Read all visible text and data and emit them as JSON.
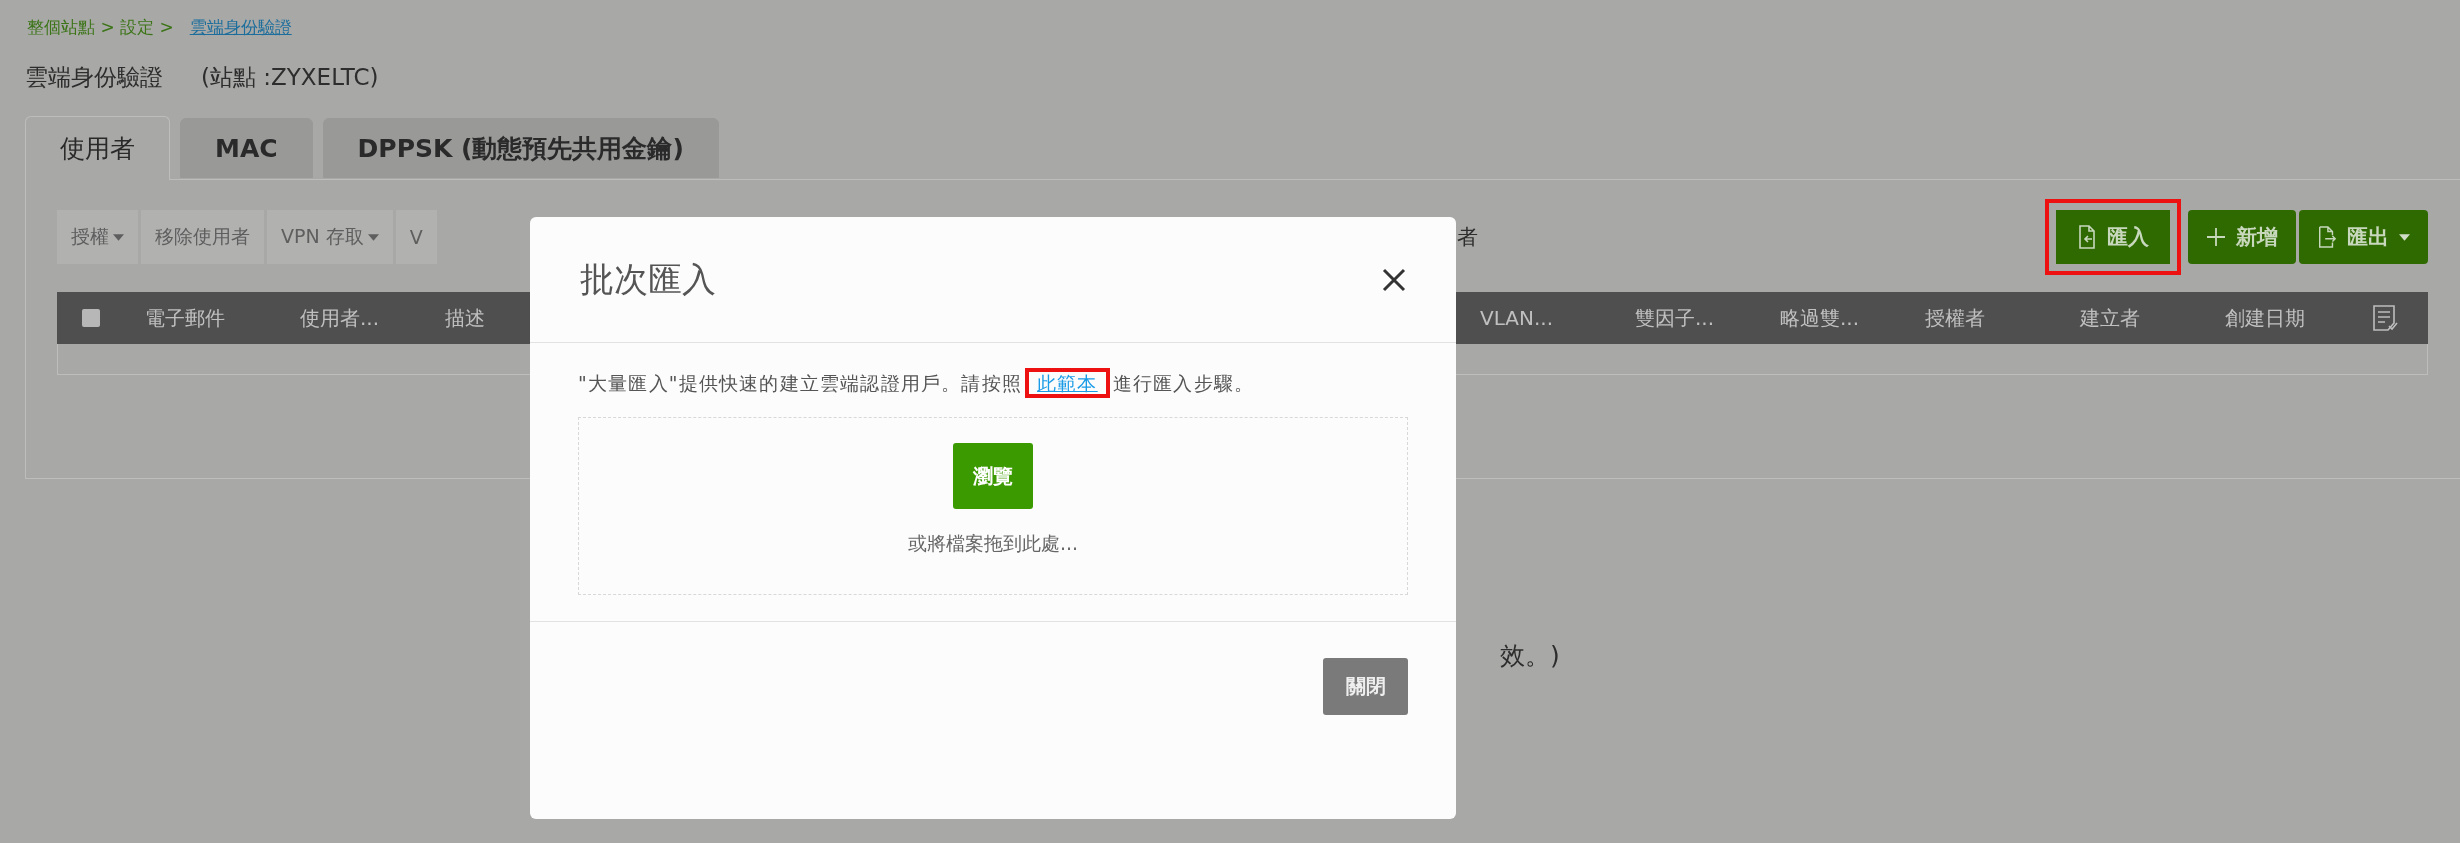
{
  "breadcrumb": {
    "path": "整個站點 > 設定 >",
    "current": "雲端身份驗證"
  },
  "page": {
    "title": "雲端身份驗證",
    "site": "(站點 :ZYXELTC)"
  },
  "tabs": [
    {
      "label": "使用者",
      "selected": true
    },
    {
      "label": "MAC",
      "selected": false
    },
    {
      "label": "DPPSK (動態預先共用金鑰)",
      "selected": false
    }
  ],
  "toolbar": {
    "actions": [
      {
        "label": "授權",
        "dropdown": true
      },
      {
        "label": "移除使用者",
        "dropdown": false
      },
      {
        "label": "VPN 存取",
        "dropdown": true
      },
      {
        "label": "V",
        "dropdown": false
      }
    ],
    "partial_text": "者",
    "buttons": [
      {
        "label": "匯入",
        "kind": "import",
        "dropdown": false,
        "highlighted": true
      },
      {
        "label": "新增",
        "kind": "add",
        "dropdown": false,
        "highlighted": false
      },
      {
        "label": "匯出",
        "kind": "export",
        "dropdown": true,
        "highlighted": false
      }
    ]
  },
  "table": {
    "select_all_checked": false,
    "columns": [
      "電子郵件",
      "使用者...",
      "描述",
      "VLAN...",
      "雙因子...",
      "略過雙...",
      "授權者",
      "建立者",
      "創建日期"
    ]
  },
  "notice": "效。)",
  "dialog": {
    "title": "批次匯入",
    "message_before": "\"大量匯入\"提供快速的建立雲端認證用戶。請按照",
    "link": {
      "label": "此範本",
      "highlighted": true
    },
    "message_after": "進行匯入步驟。",
    "browse_button": "瀏覽",
    "drop_hint": "或將檔案拖到此處...",
    "close_button": "關閉"
  }
}
